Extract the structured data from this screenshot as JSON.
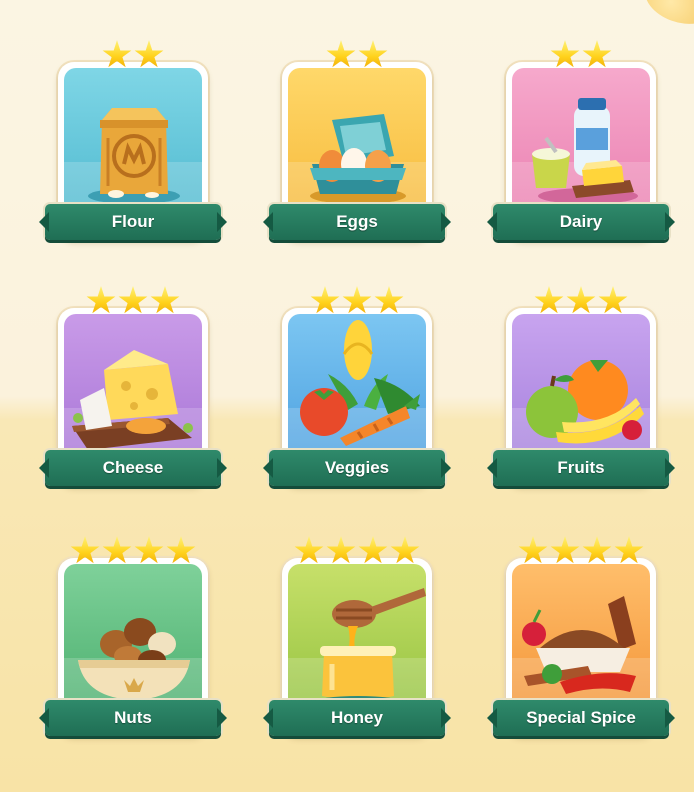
{
  "screen": "ingredient-card-collection",
  "cards": [
    {
      "id": "flour",
      "label": "Flour",
      "stars": 2,
      "bg_top": "#7fd6e6",
      "bg_bottom": "#4fb9cf",
      "icon": "flour-sack-icon"
    },
    {
      "id": "eggs",
      "label": "Eggs",
      "stars": 2,
      "bg_top": "#ffd86a",
      "bg_bottom": "#f6b93a",
      "icon": "egg-carton-icon"
    },
    {
      "id": "dairy",
      "label": "Dairy",
      "stars": 2,
      "bg_top": "#f6a9cc",
      "bg_bottom": "#ea7fb0",
      "icon": "dairy-products-icon"
    },
    {
      "id": "cheese",
      "label": "Cheese",
      "stars": 3,
      "bg_top": "#c99be8",
      "bg_bottom": "#a774d6",
      "icon": "cheese-board-icon"
    },
    {
      "id": "veggies",
      "label": "Veggies",
      "stars": 3,
      "bg_top": "#7cc6f2",
      "bg_bottom": "#4b9fdf",
      "icon": "vegetables-icon"
    },
    {
      "id": "fruits",
      "label": "Fruits",
      "stars": 3,
      "bg_top": "#c8a4ef",
      "bg_bottom": "#a47fdc",
      "icon": "fruits-icon"
    },
    {
      "id": "nuts",
      "label": "Nuts",
      "stars": 4,
      "bg_top": "#7fd19a",
      "bg_bottom": "#4aae6d",
      "icon": "nut-bowl-icon"
    },
    {
      "id": "honey",
      "label": "Honey",
      "stars": 4,
      "bg_top": "#c7e06a",
      "bg_bottom": "#93c23f",
      "icon": "honey-jar-icon"
    },
    {
      "id": "special-spice",
      "label": "Special Spice",
      "stars": 4,
      "bg_top": "#ffbe6b",
      "bg_bottom": "#f39437",
      "icon": "spice-bowl-icon"
    }
  ]
}
